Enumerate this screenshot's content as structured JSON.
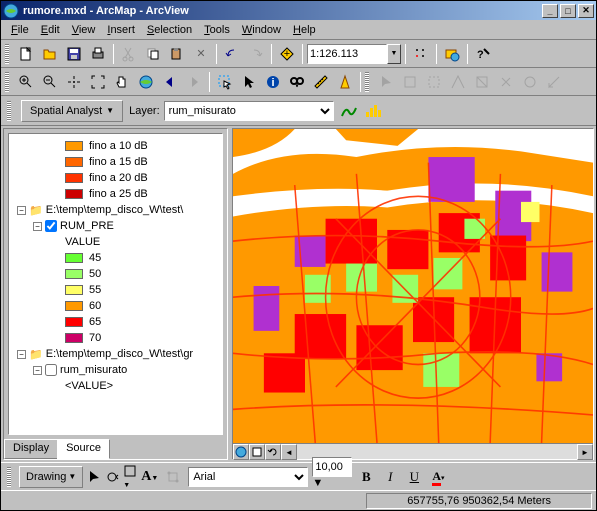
{
  "window": {
    "title": "rumore.mxd - ArcMap - ArcView"
  },
  "menu": {
    "file": "File",
    "edit": "Edit",
    "view": "View",
    "insert": "Insert",
    "selection": "Selection",
    "tools": "Tools",
    "window": "Window",
    "help": "Help"
  },
  "toolbar": {
    "scale": "1:126.113"
  },
  "analyst": {
    "label": "Spatial Analyst",
    "layer_label": "Layer:",
    "layer_value": "rum_misurato"
  },
  "toc": {
    "legend1": [
      {
        "label": "fino a 10 dB",
        "color": "#ff9900"
      },
      {
        "label": "fino a 15 dB",
        "color": "#ff6600"
      },
      {
        "label": "fino a 20 dB",
        "color": "#ff3300"
      },
      {
        "label": "fino a 25 dB",
        "color": "#cc0000"
      }
    ],
    "group1_path": "E:\\temp\\temp_disco_W\\test\\",
    "layer1_name": "RUM_PRE",
    "value_label": "VALUE",
    "legend2": [
      {
        "label": "45",
        "color": "#66ff33"
      },
      {
        "label": "50",
        "color": "#99ff66"
      },
      {
        "label": "55",
        "color": "#ffff66"
      },
      {
        "label": "60",
        "color": "#ff9900"
      },
      {
        "label": "65",
        "color": "#ff0000"
      },
      {
        "label": "70",
        "color": "#cc0066"
      }
    ],
    "group2_path": "E:\\temp\\temp_disco_W\\test\\gr",
    "layer2_name": "rum_misurato",
    "value2_label": "<VALUE>",
    "tab_display": "Display",
    "tab_source": "Source"
  },
  "drawing": {
    "label": "Drawing",
    "font": "Arial",
    "size": "10,00",
    "bold": "B",
    "italic": "I",
    "underline": "U"
  },
  "status": {
    "coords": "657755,76  950362,54 Meters"
  },
  "colors": {
    "orange": "#ff9900",
    "red": "#ff0000",
    "purple": "#b030d0",
    "green": "#99ff66",
    "yellow": "#ffff66",
    "white": "#ffffff"
  }
}
